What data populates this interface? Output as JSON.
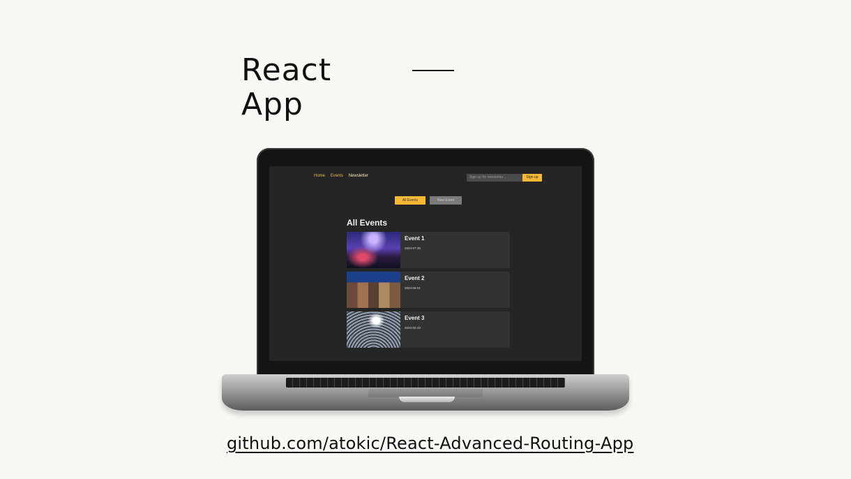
{
  "slide": {
    "title_line1": "React",
    "title_line2": "App",
    "repo_link": "github.com/atokic/React-Advanced-Routing-App"
  },
  "app": {
    "nav": {
      "items": [
        {
          "label": "Home",
          "active": false
        },
        {
          "label": "Events",
          "active": false
        },
        {
          "label": "Newsletter",
          "active": true
        }
      ]
    },
    "newsletter": {
      "placeholder": "Sign up for newsletter...",
      "button_label": "Sign up"
    },
    "events_nav": {
      "all_events_label": "All Events",
      "new_event_label": "New Event"
    },
    "page_heading": "All Events",
    "events": [
      {
        "title": "Event 1",
        "date": "2024-07-30",
        "image": "concert-stage-crowd"
      },
      {
        "title": "Event 2",
        "date": "2024-06-01",
        "image": "city-square-market"
      },
      {
        "title": "Event 3",
        "date": "2023-02-22",
        "image": "conference-audience"
      }
    ]
  },
  "colors": {
    "accent": "#f5b935",
    "app_background": "#252525",
    "card_background": "#323232",
    "slide_background": "#f8f8f4"
  }
}
